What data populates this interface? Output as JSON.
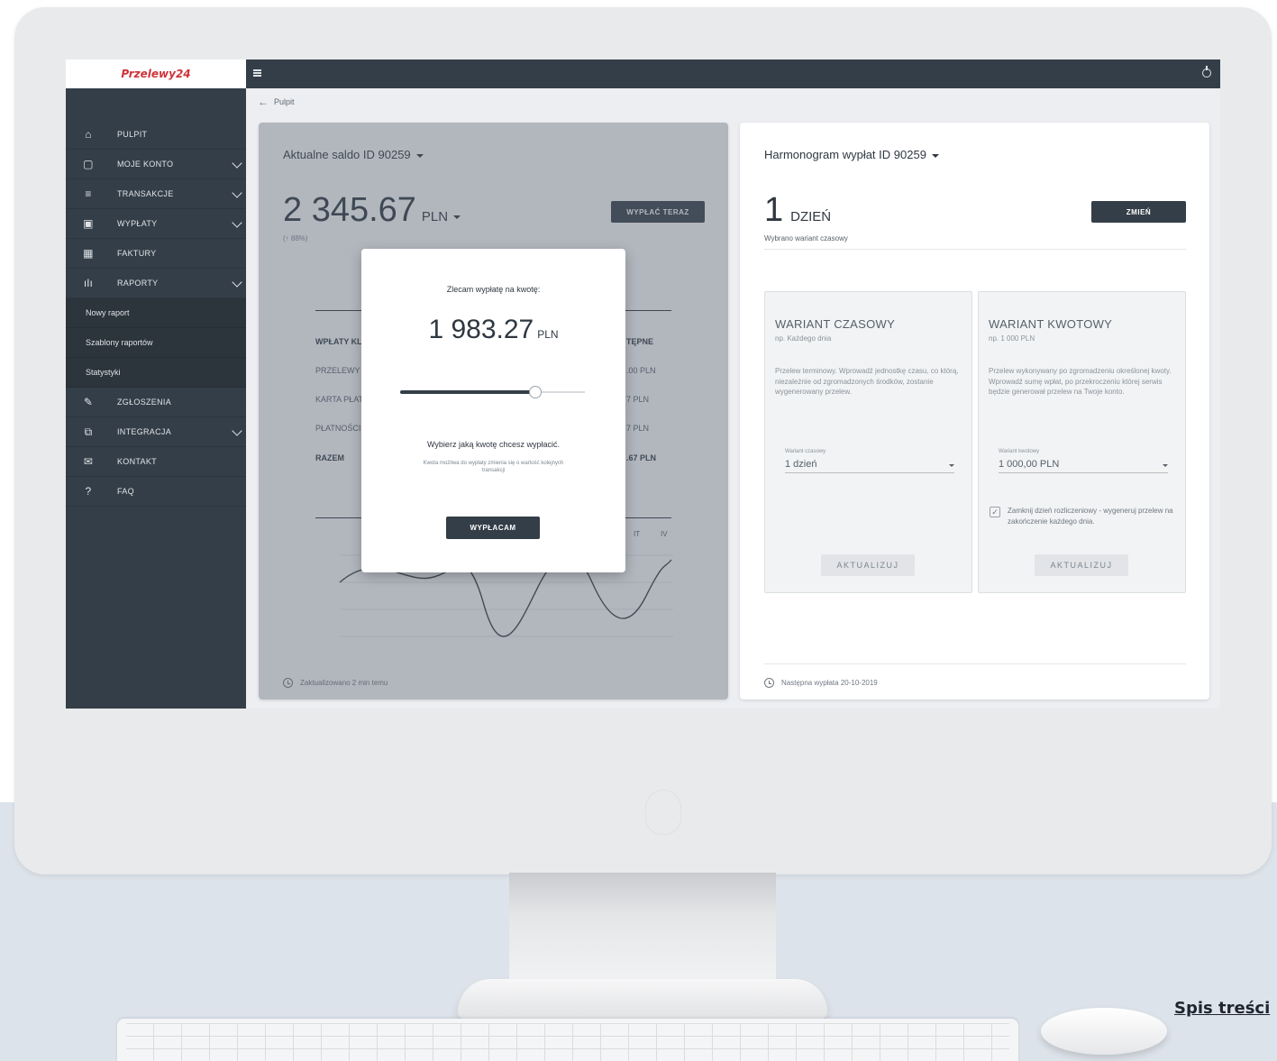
{
  "app": {
    "logo_text": "Przelewy24"
  },
  "sidebar": {
    "items": [
      {
        "label": "PULPIT",
        "icon": "home-icon"
      },
      {
        "label": "MOJE KONTO",
        "icon": "briefcase-icon",
        "has_submenu": true
      },
      {
        "label": "TRANSAKCJE",
        "icon": "list-icon",
        "has_submenu": true
      },
      {
        "label": "WYPŁATY",
        "icon": "wallet-icon",
        "has_submenu": true
      },
      {
        "label": "FAKTURY",
        "icon": "calendar-icon"
      },
      {
        "label": "RAPORTY",
        "icon": "bar-chart-icon",
        "has_submenu": true,
        "expanded": true
      }
    ],
    "sub_items": [
      {
        "label": "Nowy raport"
      },
      {
        "label": "Szablony raportów"
      },
      {
        "label": "Statystyki"
      }
    ],
    "items_after": [
      {
        "label": "ZGŁOSZENIA",
        "icon": "pencil-icon"
      },
      {
        "label": "INTEGRACJA",
        "icon": "puzzle-icon",
        "has_submenu": true
      },
      {
        "label": "KONTAKT",
        "icon": "mail-icon"
      },
      {
        "label": "FAQ",
        "icon": "help-icon"
      }
    ]
  },
  "breadcrumb": {
    "label": "Pulpit"
  },
  "balance_card": {
    "title": "Aktualne saldo ID 90259",
    "value": "2 345.67",
    "unit": "PLN",
    "change": "(↑ 88%)",
    "button": "WYPŁAĆ TERAZ",
    "table_header_left": "WPŁATY KL",
    "table_header_right": "TĘPNE",
    "rows": [
      {
        "label": "PRZELEWY",
        "value": ".00 PLN"
      },
      {
        "label": "KARTA PŁAT",
        "value": "7 PLN"
      },
      {
        "label": "PŁATNOŚCI",
        "value": "7 PLN"
      },
      {
        "label": "RAZEM",
        "value": ".67 PLN"
      }
    ],
    "chart_tabs": [
      "IT",
      "IV"
    ],
    "footer": "Zaktualizowano 2 min temu"
  },
  "modal": {
    "title": "Zlecam wypłatę na kwotę:",
    "amount": "1 983.27",
    "unit": "PLN",
    "slider_fraction": 0.73,
    "question": "Wybierz jaką kwotę chcesz wypłacić.",
    "note": "Kwota możliwa do wypłaty zmienia się o wartość kolejnych transakcji",
    "button": "WYPŁACAM"
  },
  "schedule_card": {
    "title": "Harmonogram wypłat ID 90259",
    "value": "1",
    "unit": "DZIEŃ",
    "note": "Wybrano wariant czasowy",
    "button": "ZMIEŃ",
    "variant_time": {
      "title": "WARIANT CZASOWY",
      "subtitle": "np. Każdego dnia",
      "description": "Przelew terminowy. Wprowadź jednostkę czasu, co którą, niezależnie od zgromadzonych środków, zostanie wygenerowany przelew.",
      "field_label": "Wariant czasowy",
      "field_value": "1 dzień",
      "button": "AKTUALIZUJ"
    },
    "variant_amount": {
      "title": "WARIANT KWOTOWY",
      "subtitle": "np. 1 000 PLN",
      "description": "Przelew wykonywany po zgromadzeniu określonej kwoty. Wprowadź sumę wpłat, po przekroczeniu której serwis będzie generował przelew na Twoje konto.",
      "field_label": "Wariant kwotowy",
      "field_value": "1 000,00 PLN",
      "checkbox_label": "Zamknij dzień rozliczeniowy - wygeneruj przelew na zakończenie każdego dnia.",
      "checkbox_checked": true,
      "button": "AKTUALIZUJ"
    },
    "footer": "Następna wypłata 20-10-2019"
  },
  "page_link": "Spis treści"
}
